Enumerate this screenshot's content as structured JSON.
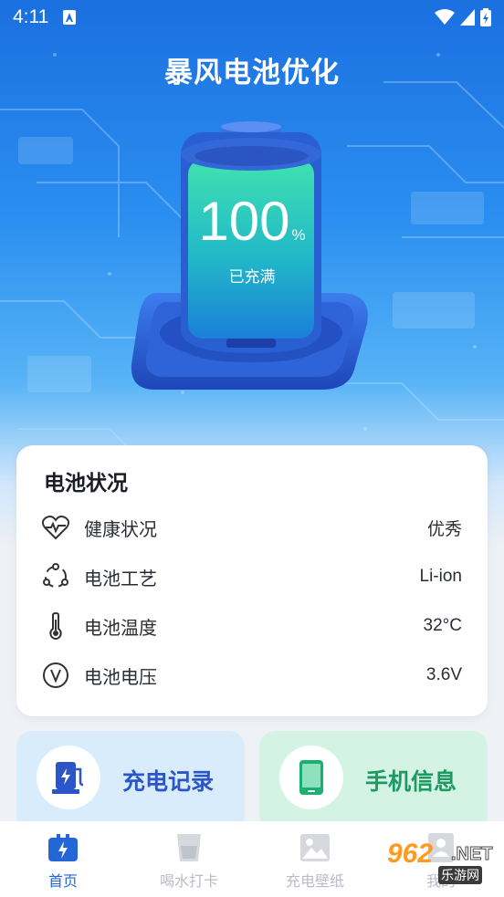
{
  "statusbar": {
    "time": "4:11"
  },
  "app": {
    "title": "暴风电池优化"
  },
  "battery": {
    "percent": "100",
    "unit": "%",
    "status": "已充满",
    "level": 1.0
  },
  "card": {
    "title": "电池状况",
    "rows": [
      {
        "icon": "heart-pulse-icon",
        "label": "健康状况",
        "value": "优秀"
      },
      {
        "icon": "process-cycle-icon",
        "label": "电池工艺",
        "value": "Li-ion"
      },
      {
        "icon": "thermometer-icon",
        "label": "电池温度",
        "value": "32°C"
      },
      {
        "icon": "voltage-icon",
        "label": "电池电压",
        "value": "3.6V"
      }
    ]
  },
  "tiles": [
    {
      "icon": "charging-station-icon",
      "label": "充电记录",
      "color": "#2c56c8"
    },
    {
      "icon": "phone-icon",
      "label": "手机信息",
      "color": "#1b9a62"
    }
  ],
  "tabs": [
    {
      "icon": "battery-bolt-icon",
      "label": "首页",
      "active": true
    },
    {
      "icon": "water-glass-icon",
      "label": "喝水打卡",
      "active": false
    },
    {
      "icon": "image-icon",
      "label": "充电壁纸",
      "active": false
    },
    {
      "icon": "user-icon",
      "label": "我的",
      "active": false
    }
  ],
  "watermark": {
    "number": "962",
    "suffix": ".NET",
    "site": "乐游网"
  },
  "colors": {
    "accent": "#2466d6",
    "hero_top": "#1b6fe0",
    "battery_liquid": "#2fd6a7"
  }
}
